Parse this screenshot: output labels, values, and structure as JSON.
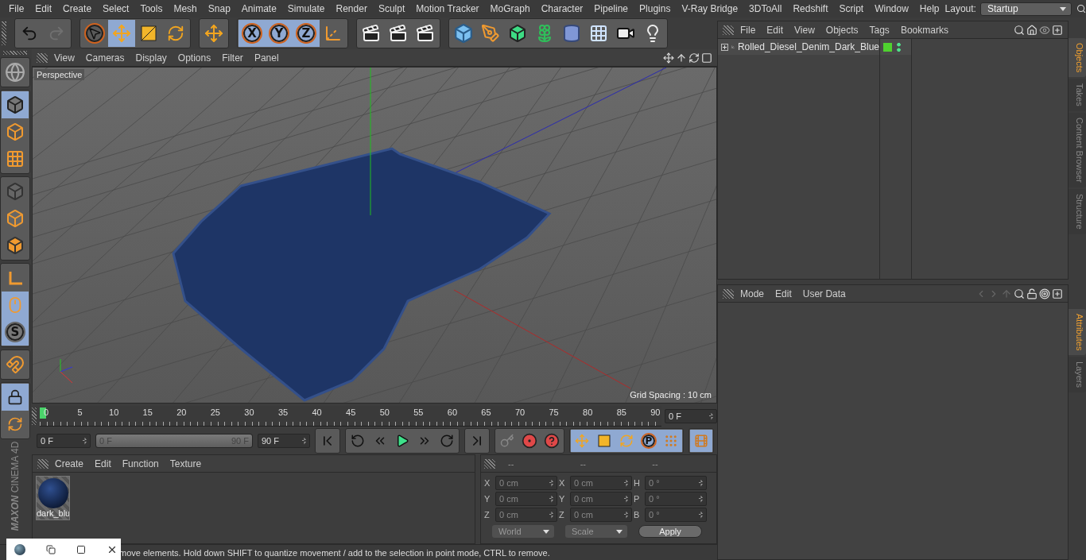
{
  "menu_bar": {
    "items": [
      "File",
      "Edit",
      "Create",
      "Select",
      "Tools",
      "Mesh",
      "Snap",
      "Animate",
      "Simulate",
      "Render",
      "Sculpt",
      "Motion Tracker",
      "MoGraph",
      "Character",
      "Pipeline",
      "Plugins",
      "V-Ray Bridge",
      "3DToAll",
      "Redshift",
      "Script",
      "Window",
      "Help"
    ],
    "layout_label": "Layout:",
    "layout_value": "Startup"
  },
  "toolbar": {
    "history": [
      {
        "disabled": false
      },
      {
        "disabled": true
      }
    ],
    "tools": [
      {
        "selected": false
      },
      {
        "selected": true
      },
      {
        "selected": false
      },
      {
        "selected": false
      }
    ],
    "axes": [
      {
        "label": "X",
        "selected": true
      },
      {
        "label": "Y",
        "selected": true
      },
      {
        "label": "Z",
        "selected": true
      }
    ]
  },
  "mode_bar": {
    "modes": [
      {
        "selected": true
      },
      {
        "selected": false
      },
      {
        "selected": false
      },
      {
        "selected": false
      },
      {
        "selected": false
      },
      {
        "selected": false
      }
    ],
    "snap": [
      {
        "selected": false
      },
      {
        "selected": true
      },
      {
        "label": "S",
        "selected": true
      }
    ]
  },
  "viewport": {
    "menu": [
      "View",
      "Cameras",
      "Display",
      "Options",
      "Filter",
      "Panel"
    ],
    "camera": "Perspective",
    "grid_spacing": "Grid Spacing : 10 cm"
  },
  "timeline": {
    "ticks": [
      "0",
      "5",
      "10",
      "15",
      "20",
      "25",
      "30",
      "35",
      "40",
      "45",
      "50",
      "55",
      "60",
      "65",
      "70",
      "75",
      "80",
      "85",
      "90"
    ],
    "playhead": {
      "level": 0
    },
    "frame": "0 F"
  },
  "playback": {
    "start": "0 F",
    "range_start": "0 F",
    "range_end": "90 F",
    "end": "90 F",
    "range": {
      "level": 1
    },
    "key_label": "P"
  },
  "materials": {
    "menu": [
      "Create",
      "Edit",
      "Function",
      "Texture"
    ],
    "items": [
      {
        "name": "dark_blu"
      }
    ]
  },
  "coordinates": {
    "headers": [
      "--",
      "--",
      "--"
    ],
    "rows": [
      {
        "axis": "X",
        "position": "0 cm",
        "size_axis": "X",
        "size": "0 cm",
        "rot_axis": "H",
        "rotation": "0 °"
      },
      {
        "axis": "Y",
        "position": "0 cm",
        "size_axis": "Y",
        "size": "0 cm",
        "rot_axis": "P",
        "rotation": "0 °"
      },
      {
        "axis": "Z",
        "position": "0 cm",
        "size_axis": "Z",
        "size": "0 cm",
        "rot_axis": "B",
        "rotation": "0 °"
      }
    ],
    "mode": "World",
    "size_mode": "Scale",
    "apply": "Apply"
  },
  "objects": {
    "menu": [
      "File",
      "Edit",
      "View",
      "Objects",
      "Tags",
      "Bookmarks"
    ],
    "items": [
      {
        "name": "Rolled_Diesel_Denim_Dark_Blue",
        "expanded": false
      }
    ]
  },
  "attributes": {
    "menu": [
      "Mode",
      "Edit",
      "User Data"
    ]
  },
  "side_tabs": {
    "top": [
      {
        "label": "Objects",
        "selected": true
      },
      {
        "label": "Takes",
        "selected": false
      },
      {
        "label": "Content Browser",
        "selected": false
      },
      {
        "label": "Structure",
        "selected": false
      }
    ],
    "bottom": [
      {
        "label": "Attributes",
        "selected": true
      },
      {
        "label": "Layers",
        "selected": false
      }
    ]
  },
  "logo": {
    "brand": "MAXON",
    "product": "CINEMA 4D"
  },
  "status_bar": {
    "text": "move elements. Hold down SHIFT to quantize movement / add to the selection in point mode, CTRL to remove."
  }
}
